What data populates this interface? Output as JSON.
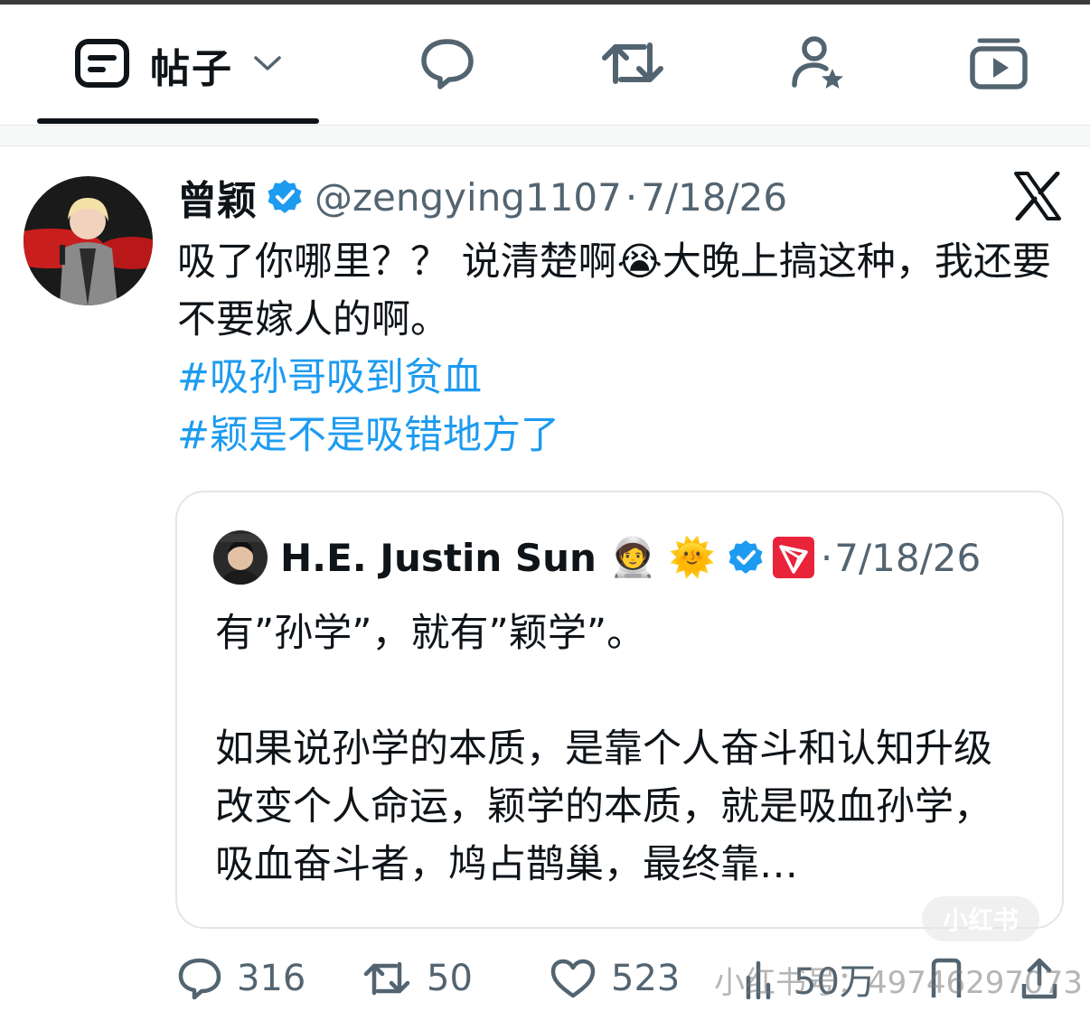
{
  "tabs": {
    "posts_label": "帖子",
    "active": "posts"
  },
  "tweet": {
    "author_name": "曾颖",
    "handle": "@zengying1107",
    "separator": "·",
    "date": "7/18/26",
    "text_line1": "吸了你哪里？？ 说清楚啊😭大晚上搞这种，我还要不要嫁人的啊。",
    "hashtag1": "#吸孙哥吸到贫血",
    "hashtag2": "#颖是不是吸错地方了"
  },
  "quote": {
    "author_name": "H.E. Justin Sun",
    "emojis": "🧑‍🚀 🌞",
    "date": "7/18/26",
    "separator": "·",
    "text": "有”孙学”，就有”颖学”。\n\n如果说孙学的本质，是靠个人奋斗和认知升级改变个人命运，颖学的本质，就是吸血孙学，吸血奋斗者，鸠占鹊巢，最终靠…"
  },
  "stats": {
    "replies": "316",
    "retweets": "50",
    "likes": "523",
    "views": "50万"
  },
  "watermark": {
    "badge": "小红书",
    "id_text": "小红书号：49746297073"
  },
  "colors": {
    "accent": "#1d9bf0",
    "text": "#0f1419",
    "muted": "#536471",
    "verified": "#1d9bf0",
    "tron_red": "#e8233a"
  }
}
